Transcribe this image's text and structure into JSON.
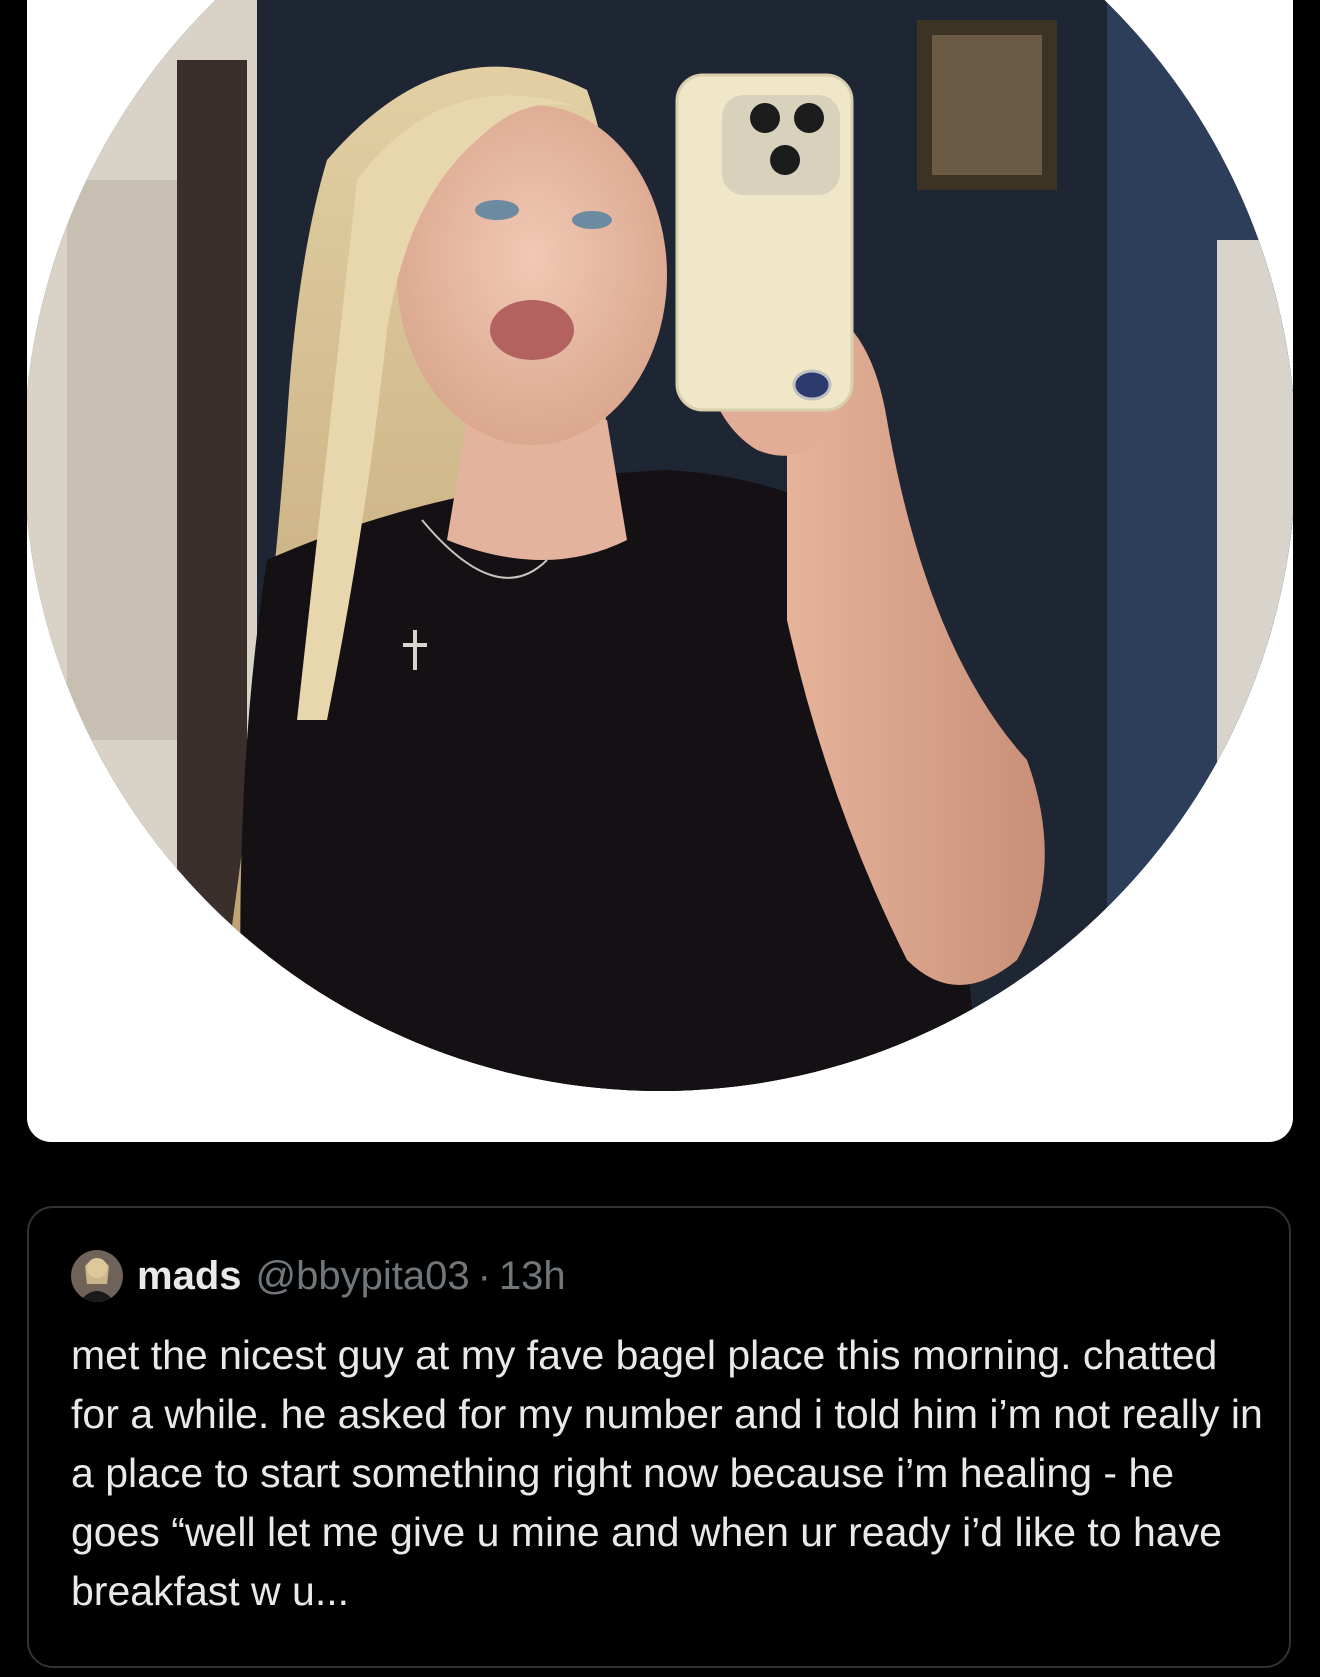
{
  "quoted_tweet": {
    "display_name": "mads",
    "handle": "@bbypita03",
    "separator": "·",
    "time": "13h",
    "text": "met the nicest guy at my fave bagel place this morning. chatted for a while. he asked for my number and i told him i’m not really in a place to start something right now because i’m healing - he goes “well let me give u mine and when ur ready i’d like to have breakfast w u..."
  },
  "colors": {
    "background": "#000000",
    "card_border": "#2f3336",
    "primary_text": "#e7e9ea",
    "secondary_text": "#71767b"
  }
}
